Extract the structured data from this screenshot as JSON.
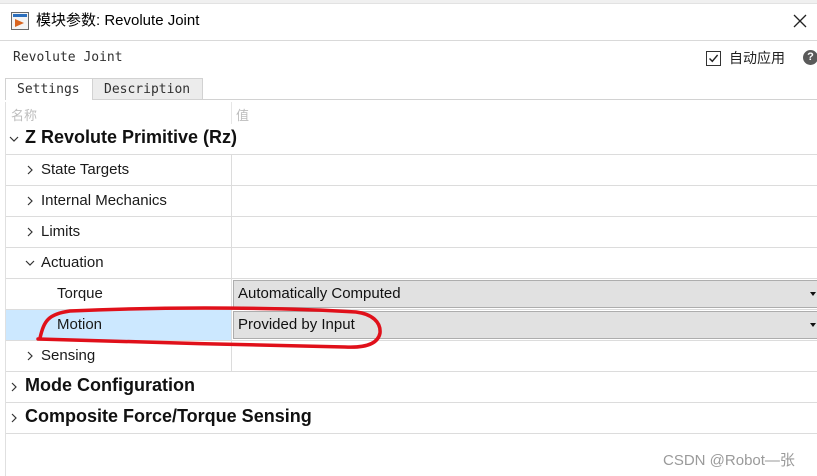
{
  "window": {
    "title": "模块参数: Revolute Joint",
    "close_icon": "close-icon",
    "app_icon": "simulink-block-icon"
  },
  "block": {
    "name": "Revolute Joint",
    "auto_apply_label": "自动应用",
    "auto_apply_checked": true,
    "help_icon": "help-icon"
  },
  "tabs": [
    {
      "label": "Settings",
      "active": true
    },
    {
      "label": "Description",
      "active": false
    }
  ],
  "table": {
    "name_header": "名称",
    "value_header": "值",
    "rows": [
      {
        "label": "Z Revolute Primitive (Rz)",
        "type": "group",
        "expanded": true,
        "value": ""
      },
      {
        "label": "State Targets",
        "type": "section",
        "expanded": false,
        "value": ""
      },
      {
        "label": "Internal Mechanics",
        "type": "section",
        "expanded": false,
        "value": ""
      },
      {
        "label": "Limits",
        "type": "section",
        "expanded": false,
        "value": ""
      },
      {
        "label": "Actuation",
        "type": "section",
        "expanded": true,
        "value": ""
      },
      {
        "label": "Torque",
        "type": "param",
        "value": "Automatically Computed",
        "selected": false
      },
      {
        "label": "Motion",
        "type": "param",
        "value": "Provided by Input",
        "selected": true
      },
      {
        "label": "Sensing",
        "type": "section",
        "expanded": false,
        "value": ""
      },
      {
        "label": "Mode Configuration",
        "type": "group",
        "expanded": false,
        "value": ""
      },
      {
        "label": "Composite Force/Torque Sensing",
        "type": "group",
        "expanded": false,
        "value": ""
      }
    ]
  },
  "annotation": {
    "shape": "hand-drawn-ellipse",
    "color": "#e0101a",
    "target": "Motion"
  },
  "watermark": "CSDN @Robot—张",
  "colors": {
    "selected_row": "#cce8ff",
    "dropdown_bg": "#e1e1e1",
    "annotation_red": "#e0101a"
  }
}
